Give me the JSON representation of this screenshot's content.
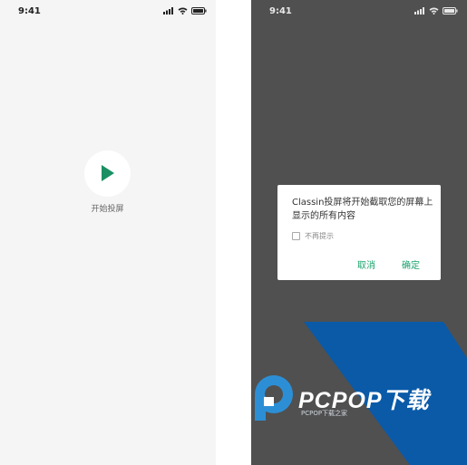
{
  "left_screen": {
    "status_time": "9:41",
    "play_label": "开始投屏"
  },
  "right_screen": {
    "status_time": "9:41",
    "dialog": {
      "message": "Classin投屏将开始截取您的屏幕上显示的所有内容",
      "checkbox_label": "不再提示",
      "checkbox_checked": false,
      "cancel_label": "取消",
      "confirm_label": "确定"
    },
    "watermark": {
      "brand": "PCPOP下载",
      "sub": "PCPOP下载之家"
    }
  },
  "colors": {
    "accent_green": "#1aa36e",
    "dark_overlay": "#505050",
    "watermark_blue": "#0a5aa8"
  },
  "icons": [
    "signal-icon",
    "wifi-icon",
    "battery-icon",
    "play-icon",
    "pcpop-logo-icon"
  ]
}
